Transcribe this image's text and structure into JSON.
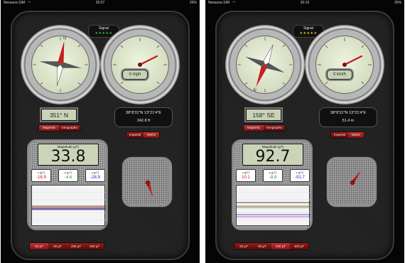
{
  "screens": [
    {
      "status": {
        "carrier": "Nessuna SIM",
        "time": "20:07",
        "battery": "26%"
      },
      "signal": {
        "label": "Signal",
        "stars": "★★★★★",
        "star_color": "#38c04a"
      },
      "compass": {
        "heading_deg": 351
      },
      "speed": {
        "value": "0 mph",
        "needle_deg": 225
      },
      "heading": {
        "text": "351° N"
      },
      "north_buttons": [
        "Magnetic",
        "Geographic"
      ],
      "coords": {
        "text": "38°8'31\"N  13°21'4\"E",
        "altitude": "242.8 ft"
      },
      "unit_buttons": [
        "Imperial",
        "Metric"
      ],
      "magnitude": {
        "title": "Magnitude (µT)",
        "value": "33.8"
      },
      "axes": [
        {
          "label": "x (µT)",
          "value": "-16.9",
          "color": "#d01010"
        },
        {
          "label": "y (µT)",
          "value": "-4.6",
          "color": "#1f9a1f"
        },
        {
          "label": "z (µT)",
          "value": "-28.9",
          "color": "#2222c8"
        }
      ],
      "needle_deg": 160,
      "scale_buttons": [
        "50 µT",
        "80 µT",
        "200 µT",
        "400 µT"
      ]
    },
    {
      "status": {
        "carrier": "Nessuna SIM",
        "time": "20:10",
        "battery": "25%"
      },
      "signal": {
        "label": "Signal",
        "stars": "★★★★★",
        "star_color": "#e0c020"
      },
      "compass": {
        "heading_deg": 158
      },
      "speed": {
        "value": "0 km/h",
        "needle_deg": 225
      },
      "heading": {
        "text": "158° SE"
      },
      "north_buttons": [
        "Magnetic",
        "Geographic"
      ],
      "coords": {
        "text": "38°8'31\"N  13°21'4\"E",
        "altitude": "51.4 m"
      },
      "unit_buttons": [
        "Imperial",
        "Metric"
      ],
      "magnitude": {
        "title": "Magnitude (µT)",
        "value": "92.7"
      },
      "axes": [
        {
          "label": "x (µT)",
          "value": "10.1",
          "color": "#d01010"
        },
        {
          "label": "y (µT)",
          "value": "-8.8",
          "color": "#1f9a1f"
        },
        {
          "label": "z (µT)",
          "value": "-91.7",
          "color": "#2222c8"
        }
      ],
      "needle_deg": 35,
      "scale_buttons": [
        "50 µT",
        "80 µT",
        "200 µT",
        "400 µT"
      ]
    }
  ]
}
